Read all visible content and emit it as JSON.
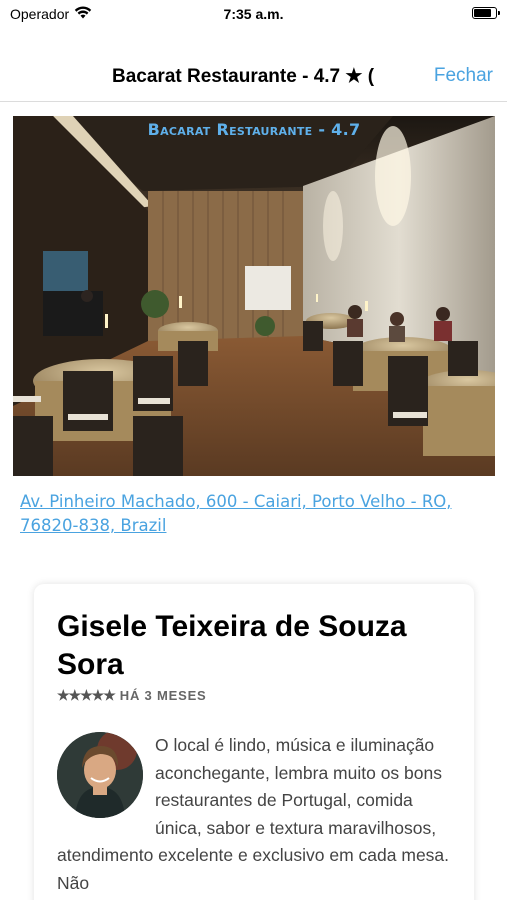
{
  "status_bar": {
    "carrier": "Operador",
    "time": "7:35 a.m.",
    "battery_level": 0.85
  },
  "nav": {
    "title": "Bacarat Restaurante - 4.7 ★ (",
    "close_label": "Fechar"
  },
  "photo": {
    "caption": "Bacarat Restaurante - 4.7 ",
    "caption_color": "#5fb0ea"
  },
  "address": {
    "text": "Av. Pinheiro Machado, 600 - Caiari, Porto Velho - RO, 76820-838, Brazil",
    "color": "#4aa3e0"
  },
  "review": {
    "author": "Gisele Teixeira de Souza Sora",
    "stars": "★★★★★",
    "rating": 5,
    "time_ago": "HÁ 3 MESES",
    "text": "O local é lindo, música e iluminação aconchegante, lembra muito os bons restaurantes de Portugal, comida única, sabor e textura maravilhosos, atendimento excelente e exclusivo em cada mesa. Não"
  },
  "icons": {
    "signal": "wifi-icon",
    "battery": "battery-icon",
    "rating": "star-icon",
    "avatar": "avatar-icon"
  },
  "accent_color": "#4aa3e0"
}
